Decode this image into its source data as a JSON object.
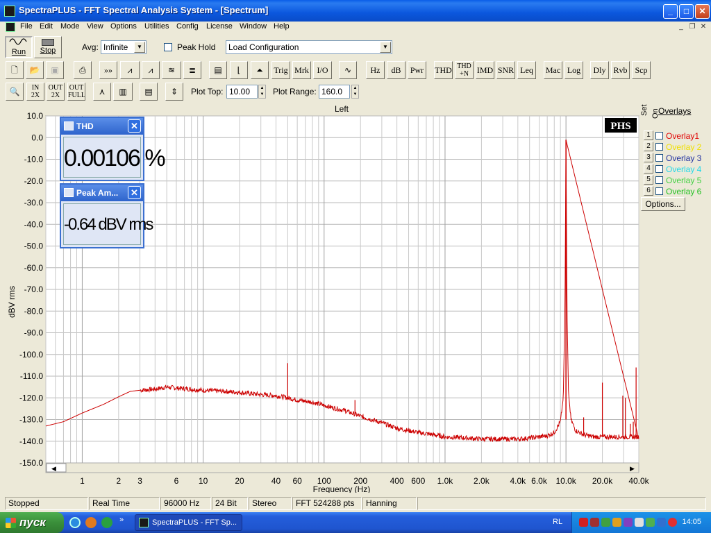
{
  "window": {
    "title": "SpectraPLUS - FFT Spectral Analysis System - [Spectrum]",
    "minimize_glyph": "_",
    "maximize_glyph": "□",
    "close_glyph": "✕"
  },
  "menu": [
    "File",
    "Edit",
    "Mode",
    "View",
    "Options",
    "Utilities",
    "Config",
    "License",
    "Window",
    "Help"
  ],
  "mdi_controls": [
    "_",
    "❐",
    "✕"
  ],
  "toolbar1": {
    "run_label": "Run",
    "stop_label": "Stop",
    "avg_label": "Avg:",
    "avg_value": "Infinite",
    "peak_hold_label": "Peak Hold",
    "load_config_value": "Load Configuration"
  },
  "toolbar2": {
    "buttons": [
      "Trig",
      "Mrk",
      "I/O",
      "Hz",
      "dB",
      "Pwr",
      "THD",
      "IMD",
      "SNR",
      "Leq",
      "Mac",
      "Log",
      "Dly",
      "Rvb",
      "Scp"
    ],
    "thd_n_top": "THD",
    "thd_n_bottom": "+N"
  },
  "toolbar3": {
    "zoom_in_top": "IN",
    "zoom_in_bottom": "2X",
    "zoom_out_top": "OUT",
    "zoom_out_bottom": "2X",
    "zoom_full_top": "OUT",
    "zoom_full_bottom": "FULL",
    "plot_top_label": "Plot Top:",
    "plot_top_value": "10.00",
    "plot_range_label": "Plot Range:",
    "plot_range_value": "160.0"
  },
  "overlays": {
    "header": "Overlays",
    "set_label": "Set",
    "on_label": "On",
    "items": [
      {
        "set": "1",
        "name": "Overlay1",
        "color": "#e00000"
      },
      {
        "set": "2",
        "name": "Overlay 2",
        "color": "#f0e000"
      },
      {
        "set": "3",
        "name": "Overlay 3",
        "color": "#2030a0"
      },
      {
        "set": "4",
        "name": "Overlay 4",
        "color": "#20d8e8"
      },
      {
        "set": "5",
        "name": "Overlay 5",
        "color": "#40d040"
      },
      {
        "set": "6",
        "name": "Overlay 6",
        "color": "#20c020"
      }
    ],
    "options_label": "Options..."
  },
  "meters": {
    "thd": {
      "title": "THD",
      "value": "0.00106 %"
    },
    "peak": {
      "title": "Peak Am...",
      "value": "-0.64 dBV rms"
    }
  },
  "status": [
    "Stopped",
    "Real Time",
    "96000 Hz",
    "24 Bit",
    "Stereo",
    "FFT 524288 pts",
    "Hanning"
  ],
  "taskbar": {
    "start_label": "пуск",
    "task_label": "SpectraPLUS - FFT Sp...",
    "lang": "RL",
    "clock": "14:05"
  },
  "chart_data": {
    "type": "line",
    "channel_title": "Left",
    "logo": "PHS",
    "xlabel": "Frequency (Hz)",
    "ylabel": "dBV rms",
    "x_scale": "log",
    "xlim": [
      0.5,
      40000
    ],
    "ylim": [
      -150,
      10
    ],
    "y_ticks": [
      "10.0",
      "0.0",
      "-10.0",
      "-20.0",
      "-30.0",
      "-40.0",
      "-50.0",
      "-60.0",
      "-70.0",
      "-80.0",
      "-90.0",
      "-100.0",
      "-110.0",
      "-120.0",
      "-130.0",
      "-140.0",
      "-150.0"
    ],
    "x_ticks": [
      {
        "v": 1,
        "label": "1"
      },
      {
        "v": 2,
        "label": "2"
      },
      {
        "v": 3,
        "label": "3"
      },
      {
        "v": 6,
        "label": "6"
      },
      {
        "v": 10,
        "label": "10"
      },
      {
        "v": 20,
        "label": "20"
      },
      {
        "v": 40,
        "label": "40"
      },
      {
        "v": 60,
        "label": "60"
      },
      {
        "v": 100,
        "label": "100"
      },
      {
        "v": 200,
        "label": "200"
      },
      {
        "v": 400,
        "label": "400"
      },
      {
        "v": 600,
        "label": "600"
      },
      {
        "v": 1000,
        "label": "1.0k"
      },
      {
        "v": 2000,
        "label": "2.0k"
      },
      {
        "v": 4000,
        "label": "4.0k"
      },
      {
        "v": 6000,
        "label": "6.0k"
      },
      {
        "v": 10000,
        "label": "10.0k"
      },
      {
        "v": 20000,
        "label": "20.0k"
      },
      {
        "v": 40000,
        "label": "40.0k"
      }
    ],
    "grid": true,
    "series": [
      {
        "color": "#cc0000",
        "points": [
          [
            0.5,
            -133
          ],
          [
            0.7,
            -131
          ],
          [
            1,
            -127
          ],
          [
            1.5,
            -123
          ],
          [
            2,
            -119.5
          ],
          [
            2.5,
            -117
          ],
          [
            3,
            -116.5
          ],
          [
            4,
            -116
          ],
          [
            5,
            -115
          ],
          [
            6,
            -115.5
          ],
          [
            8,
            -116
          ],
          [
            10,
            -116.5
          ],
          [
            15,
            -117
          ],
          [
            20,
            -117.5
          ],
          [
            30,
            -118.5
          ],
          [
            40,
            -119
          ],
          [
            50,
            -120
          ],
          [
            60,
            -121
          ],
          [
            80,
            -122
          ],
          [
            100,
            -123.5
          ],
          [
            150,
            -126
          ],
          [
            200,
            -128.5
          ],
          [
            300,
            -131.5
          ],
          [
            400,
            -134
          ],
          [
            600,
            -136
          ],
          [
            800,
            -137
          ],
          [
            1000,
            -138
          ],
          [
            1500,
            -138.5
          ],
          [
            2000,
            -139
          ],
          [
            3000,
            -139
          ],
          [
            4000,
            -139
          ],
          [
            5000,
            -138.5
          ],
          [
            6000,
            -138
          ],
          [
            7000,
            -137.5
          ],
          [
            8000,
            -136
          ],
          [
            9000,
            -131
          ],
          [
            9500,
            -120
          ],
          [
            9800,
            -80
          ],
          [
            10000,
            -1
          ],
          [
            10200,
            -80
          ],
          [
            10500,
            -118
          ],
          [
            11000,
            -130
          ],
          [
            12000,
            -135
          ],
          [
            14000,
            -137
          ],
          [
            17000,
            -138
          ],
          [
            20000,
            -138
          ],
          [
            25000,
            -138
          ],
          [
            30000,
            -138
          ],
          [
            35000,
            -138
          ],
          [
            40000,
            -138
          ]
        ],
        "spikes": [
          [
            50,
            -104
          ],
          [
            150,
            -125
          ],
          [
            180,
            -121
          ],
          [
            220,
            -130
          ],
          [
            9000,
            -131
          ],
          [
            14000,
            -129
          ],
          [
            20000,
            -113
          ],
          [
            29500,
            -119
          ],
          [
            31000,
            -120
          ],
          [
            34000,
            -132
          ],
          [
            36000,
            -131
          ],
          [
            38000,
            -106
          ]
        ]
      }
    ]
  }
}
